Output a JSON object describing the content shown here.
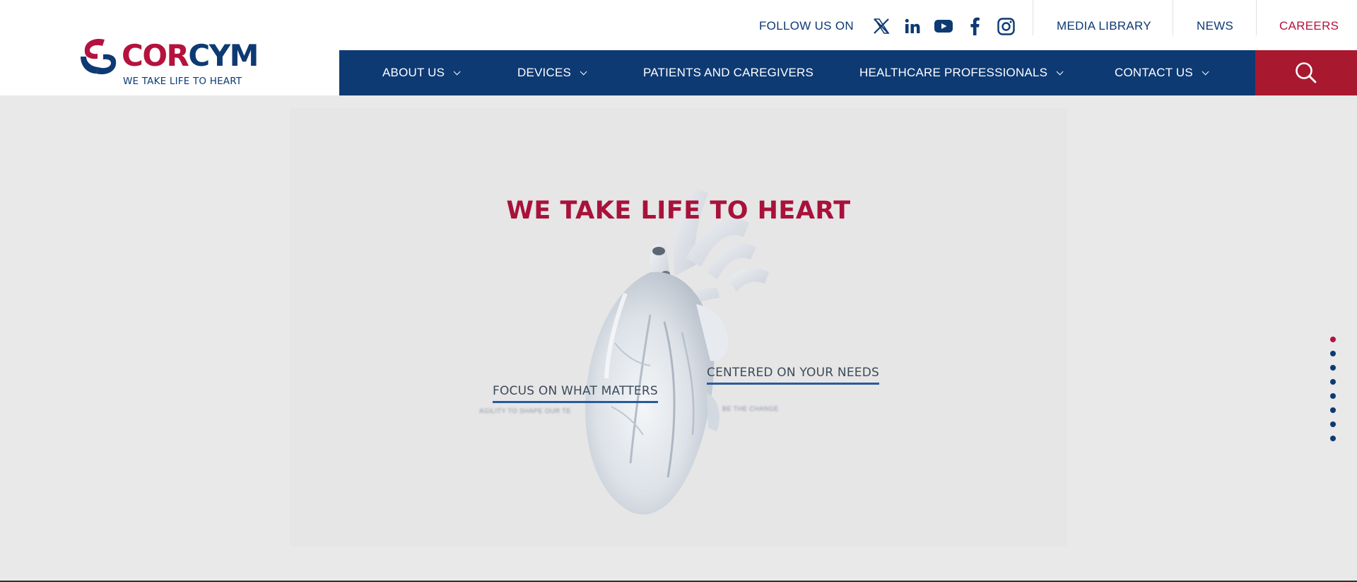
{
  "brand": {
    "logo_word_part1": "COR",
    "logo_word_part2": "CYM",
    "tagline": "WE TAKE LIFE TO HEART",
    "color_primary": "#0e3a73",
    "color_accent": "#b5123e"
  },
  "utility": {
    "follow_label": "FOLLOW US ON",
    "social_icons": [
      "x-icon",
      "linkedin-icon",
      "youtube-icon",
      "facebook-icon",
      "instagram-icon"
    ],
    "links": [
      "MEDIA LIBRARY",
      "NEWS",
      "CAREERS"
    ]
  },
  "nav": {
    "items": [
      {
        "label": "ABOUT US",
        "dropdown": true
      },
      {
        "label": "DEVICES",
        "dropdown": true
      },
      {
        "label": "PATIENTS AND CAREGIVERS",
        "dropdown": false
      },
      {
        "label": "HEALTHCARE PROFESSIONALS",
        "dropdown": true
      },
      {
        "label": "CONTACT US",
        "dropdown": true
      }
    ],
    "search_icon": "search-icon"
  },
  "hero": {
    "title": "WE TAKE LIFE TO HEART",
    "link_left": "FOCUS ON WHAT MATTERS",
    "link_left_sub": "AGILITY TO SHAPE OUR TE",
    "link_right": "CENTERED ON YOUR NEEDS",
    "link_right_sub": "BE THE CHANGE"
  },
  "slides": {
    "total": 8,
    "active_index": 0
  }
}
